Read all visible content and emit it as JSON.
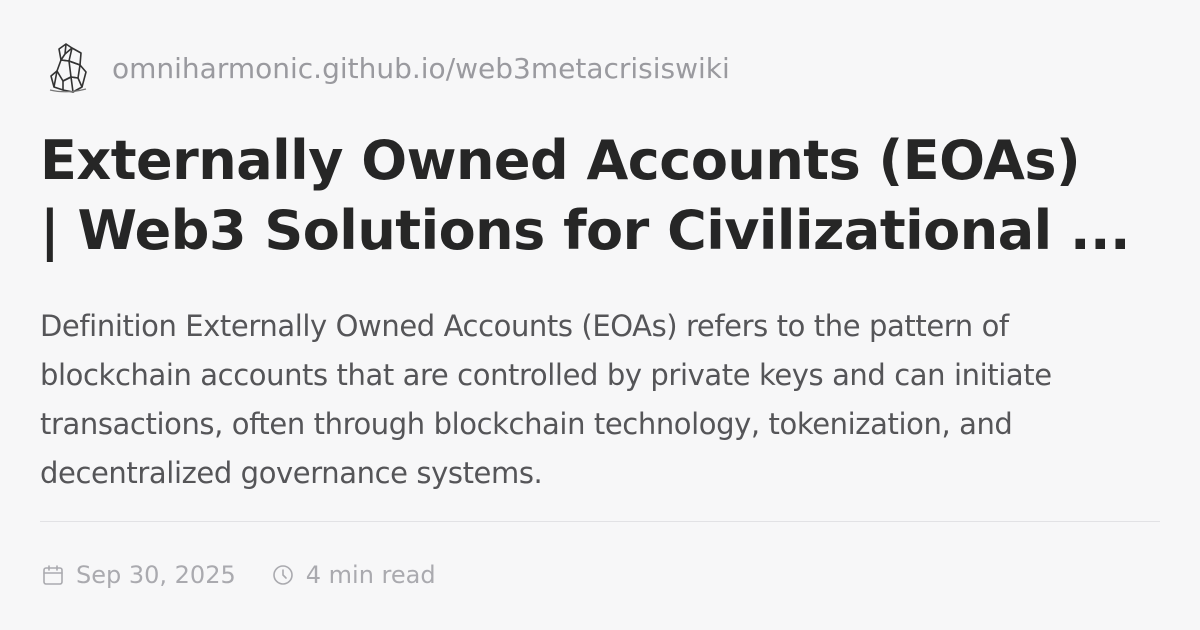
{
  "site": {
    "logo_icon": "crystal-logo-icon",
    "url": "omniharmonic.github.io/web3metacrisiswiki"
  },
  "article": {
    "title_lines": [
      "Externally Owned Accounts (EOAs)",
      "| Web3 Solutions for Civilizational ..."
    ],
    "description_lines": [
      "Definition Externally Owned Accounts (EOAs) refers to the pattern of",
      "blockchain accounts that are controlled by private keys and can initiate",
      "transactions, often through blockchain technology, tokenization, and",
      "decentralized governance systems."
    ]
  },
  "meta": {
    "date_icon": "calendar-icon",
    "date": "Sep 30, 2025",
    "read_time_icon": "clock-icon",
    "read_time": "4 min read"
  },
  "colors": {
    "background": "#f7f7f8",
    "title": "#262626",
    "description": "#555558",
    "muted": "#9a9a9f",
    "divider": "#e2e2e5"
  }
}
